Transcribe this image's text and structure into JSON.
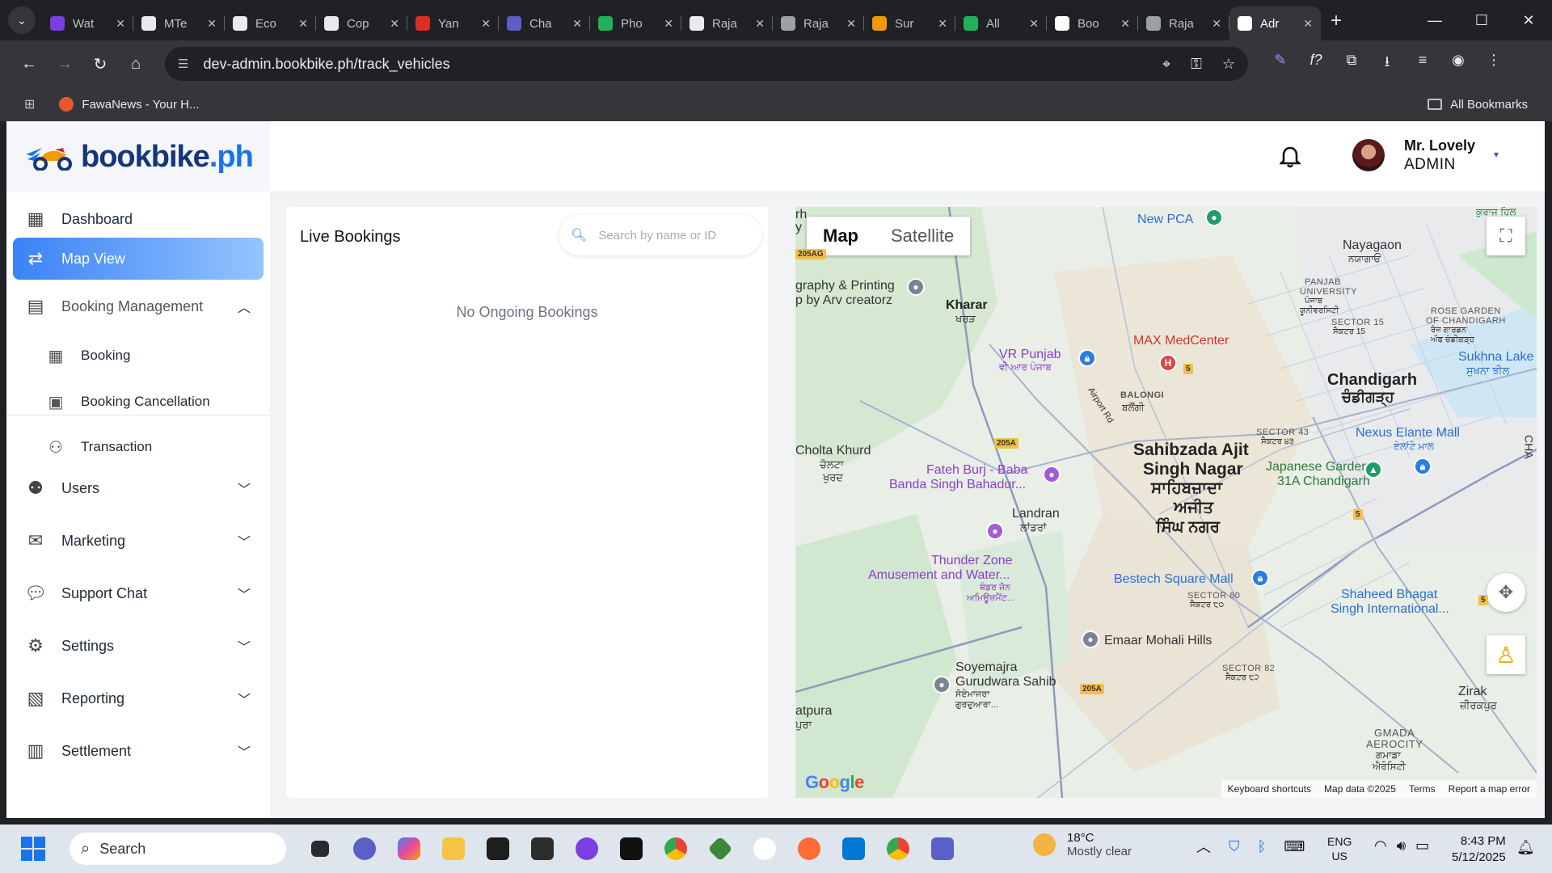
{
  "browser": {
    "tabs": [
      {
        "label": "Wat",
        "color": "#7b3fe4"
      },
      {
        "label": "MTe",
        "color": "#e8eaed"
      },
      {
        "label": "Eco",
        "color": "#e8eaed"
      },
      {
        "label": "Cop",
        "color": "#e8eaed"
      },
      {
        "label": "Yan",
        "color": "#d93025"
      },
      {
        "label": "Cha",
        "color": "#5b5fc7"
      },
      {
        "label": "Pho",
        "color": "#1fb25a"
      },
      {
        "label": "Raja",
        "color": "#e8eaed"
      },
      {
        "label": "Raja",
        "color": "#9aa0a6"
      },
      {
        "label": "Sur",
        "color": "#f29900"
      },
      {
        "label": "All",
        "color": "#1fb25a"
      },
      {
        "label": "Boo",
        "color": "#ffffff"
      },
      {
        "label": "Raja",
        "color": "#9aa0a6"
      },
      {
        "label": "Adr",
        "color": "#ffffff"
      }
    ],
    "url": "dev-admin.bookbike.ph/track_vehicles",
    "bookmarks": [
      {
        "label": "FawaNews - Your H..."
      }
    ],
    "all_bookmarks": "All Bookmarks"
  },
  "header": {
    "logo_main": "bookbike",
    "logo_dot": ".ph",
    "user_name": "Mr. Lovely",
    "user_role": "ADMIN"
  },
  "sidebar": {
    "items": [
      {
        "label": "Dashboard",
        "icon": "dashboard-icon"
      },
      {
        "label": "Map View",
        "icon": "map-route-icon",
        "active": true
      },
      {
        "label": "Booking Management",
        "icon": "calendar-icon",
        "expanded": true
      },
      {
        "label": "Users",
        "icon": "users-icon"
      },
      {
        "label": "Marketing",
        "icon": "mail-icon"
      },
      {
        "label": "Support Chat",
        "icon": "chat-icon"
      },
      {
        "label": "Settings",
        "icon": "gear-icon"
      },
      {
        "label": "Reporting",
        "icon": "report-icon"
      },
      {
        "label": "Settlement",
        "icon": "settlement-icon"
      }
    ],
    "sub_items": [
      {
        "label": "Booking",
        "icon": "calendar-grid-icon"
      },
      {
        "label": "Booking Cancellation",
        "icon": "calendar-cancel-icon"
      },
      {
        "label": "Transaction",
        "icon": "handshake-icon"
      }
    ]
  },
  "bookings": {
    "title": "Live Bookings",
    "search_placeholder": "Search by name or ID",
    "empty_text": "No Ongoing Bookings"
  },
  "map": {
    "type_map": "Map",
    "type_satellite": "Satellite",
    "labels": {
      "new_pca": "New PCA",
      "kharar": "Kharar",
      "kharar_pa": "ਖਰੜ",
      "graphy": "graphy & Printing",
      "arv": "p by Arv creatorz",
      "vr_punjab": "VR Punjab",
      "vr_punjab_pa": "ਵੀ ਆਰ ਪੰਜਾਬ",
      "max": "MAX MedCenter",
      "balongi": "BALONGI",
      "balongi_pa": "ਬਲੌਂਗੀ",
      "nayagaon": "Nayagaon",
      "nayagaon_pa": "ਨਯਾਗਾਓਂ",
      "panjab_univ": "PANJAB",
      "panjab_univ2": "UNIVERSITY",
      "sector15": "SECTOR 15",
      "rose_garden": "ROSE GARDEN",
      "rose_garden2": "OF CHANDIGARH",
      "sukhna": "Sukhna Lake",
      "sukhna_pa": "ਸੁਖਨਾ ਝੀਲ",
      "chandigarh": "Chandigarh",
      "chandigarh_pa": "ਚੰਡੀਗੜ੍ਹ",
      "sector43": "SECTOR 43",
      "nexus": "Nexus Elante Mall",
      "nexus_pa": "ਏਲਾਂਟੇ ਮਾਲ",
      "japanese": "Japanese Garden,",
      "japanese2": "31A Chandigarh",
      "sas1": "Sahibzada Ajit",
      "sas2": "Singh Nagar",
      "sas3": "ਸਾਹਿਬਜ਼ਾਦਾ",
      "sas4": "ਅਜੀਤ",
      "sas5": "ਸਿੰਘ ਨਗਰ",
      "cholta": "Cholta Khurd",
      "cholta_pa": "ਚੋਲਟਾ",
      "cholta_pa2": "ਖੁਰਦ",
      "fateh": "Fateh Burj - Baba",
      "fateh2": "Banda Singh Bahadur...",
      "landran": "Landran",
      "landran_pa": "ਲਾਂਡਰਾਂ",
      "thunder": "Thunder Zone",
      "thunder2": "Amusement and Water...",
      "thunder_pa": "ਥੰਡਰ ਜ਼ੋਨ",
      "thunder_pa2": "ਅਮਿਊਜ਼ਮੈਂਟ...",
      "bestech": "Bestech Square Mall",
      "sector80": "SECTOR 80",
      "sector80_pa": "ਸੈਕਟਰ ੮੦",
      "shaheed": "Shaheed Bhagat",
      "shaheed2": "Singh International...",
      "emaar": "Emaar Mohali Hills",
      "soyemajra": "Soyemajra",
      "soyemajra2": "Gurudwara Sahib",
      "soyemajra_pa": "ਸੋਏਮਾਜਰਾ",
      "soyemajra_pa2": "ਗੁਰਦੁਆਰਾ...",
      "sector82": "SECTOR 82",
      "sector82_pa": "ਸੈਕਟਰ ੮੨",
      "zirak": "Zirak",
      "zirak_pa": "ਜ਼ੀਰਕਪੁਰ",
      "gmada": "GMADA",
      "gmada2": "AEROCITY",
      "gmada_pa": "ਗਮਾਡਾ",
      "gmada_pa2": "ਐਰੋਸਿਟੀ",
      "atpura": "atpura",
      "atpura_pa": "ਪੁਰਾ",
      "airport_rd": "Airport Rd",
      "r205ag": "205AG",
      "r205a_1": "205A",
      "r205a_2": "205A",
      "r5_1": "5",
      "r5_2": "5",
      "r5_3": "5",
      "sector15_pa": "ਸੈਕਟਰ 15",
      "rose_garden_pa": "ਰੋਜ਼ ਗਾਰਡਨ",
      "rose_garden_pa2": "ਔਫ ਚੰਡੀਗੜ੍ਹ",
      "panjab_pa": "ਪੰਜਾਬ",
      "panjab_pa2": "ਯੂਨੀਵਰਸਿਟੀ",
      "sector43_pa": "ਸੈਕਟਰ ੪੩",
      "top_left": "rh",
      "top_left2": "y",
      "top_right": "ਕੁਰਾਜ ਹਿਲ",
      "cha": "CHA"
    },
    "google": "Google",
    "footer": [
      "Keyboard shortcuts",
      "Map data ©2025",
      "Terms",
      "Report a map error"
    ]
  },
  "taskbar": {
    "search": "Search",
    "temperature": "18°C",
    "weather": "Mostly clear",
    "lang1": "ENG",
    "lang2": "US",
    "time": "8:43 PM",
    "date": "5/12/2025"
  }
}
